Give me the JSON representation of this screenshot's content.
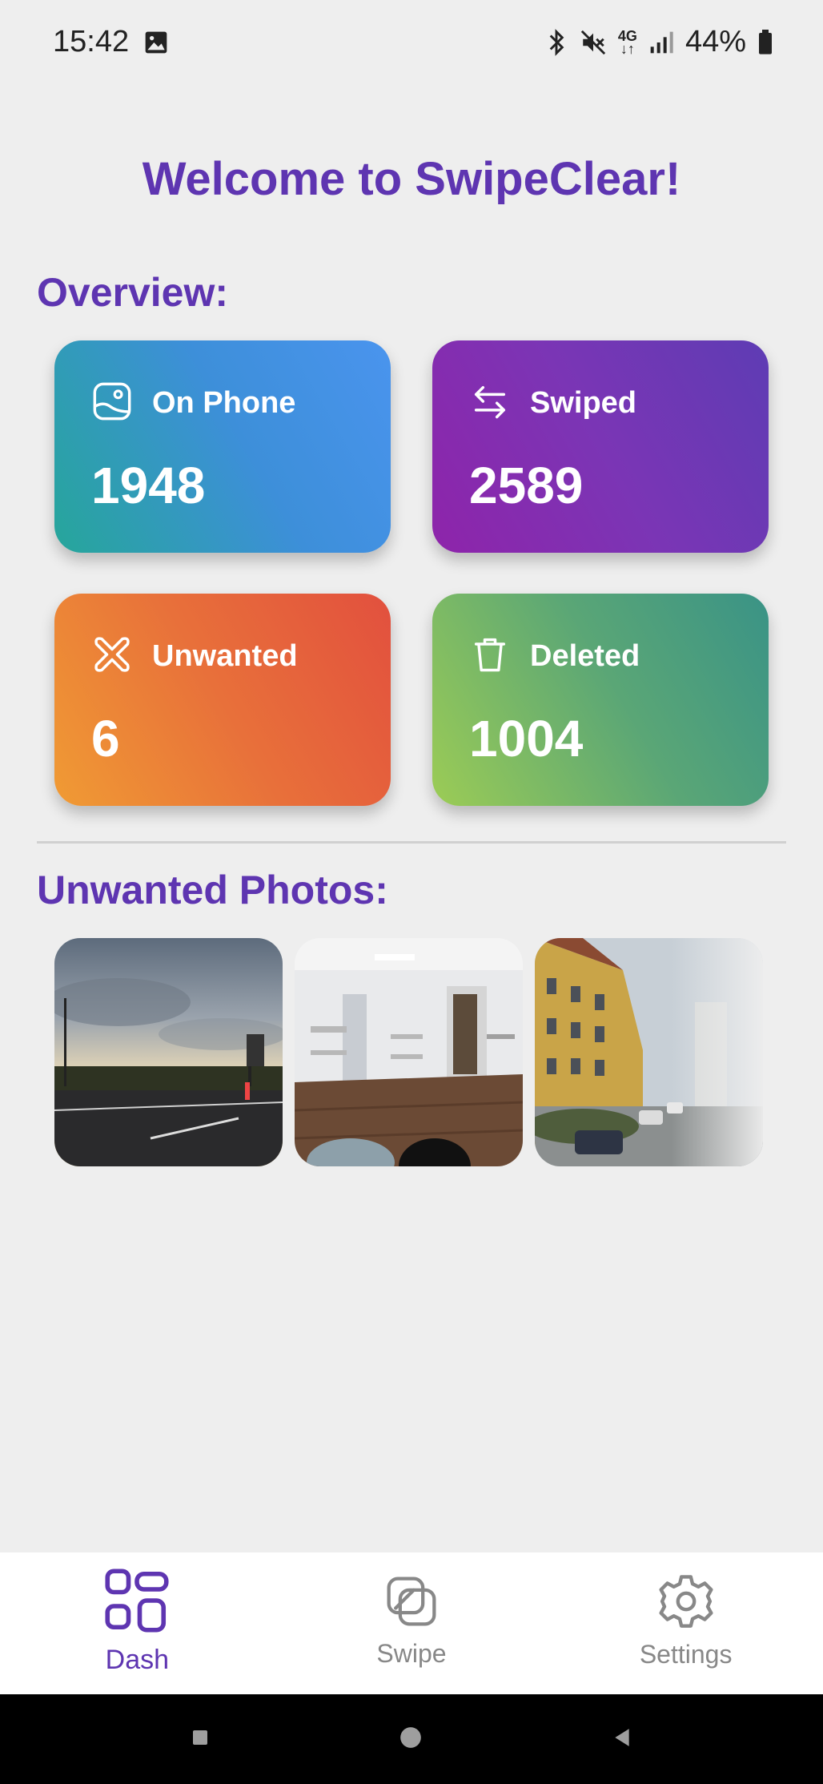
{
  "status_bar": {
    "time": "15:42",
    "network": "4G",
    "battery": "44%"
  },
  "welcome_title": "Welcome to SwipeClear!",
  "overview": {
    "title": "Overview:",
    "cards": [
      {
        "label": "On Phone",
        "value": "1948",
        "icon": "phone-photo-icon"
      },
      {
        "label": "Swiped",
        "value": "2589",
        "icon": "swap-arrows-icon"
      },
      {
        "label": "Unwanted",
        "value": "6",
        "icon": "x-cross-icon"
      },
      {
        "label": "Deleted",
        "value": "1004",
        "icon": "trash-icon"
      }
    ]
  },
  "unwanted": {
    "title": "Unwanted Photos:",
    "photos": [
      "sunset-road-photo",
      "office-room-photo",
      "street-buildings-photo"
    ]
  },
  "bottom_nav": {
    "items": [
      {
        "label": "Dash",
        "icon": "grid-icon",
        "active": true
      },
      {
        "label": "Swipe",
        "icon": "swipe-cards-icon",
        "active": false
      },
      {
        "label": "Settings",
        "icon": "gear-icon",
        "active": false
      }
    ]
  },
  "colors": {
    "accent": "#5e35b1",
    "background": "#eeeeee"
  }
}
